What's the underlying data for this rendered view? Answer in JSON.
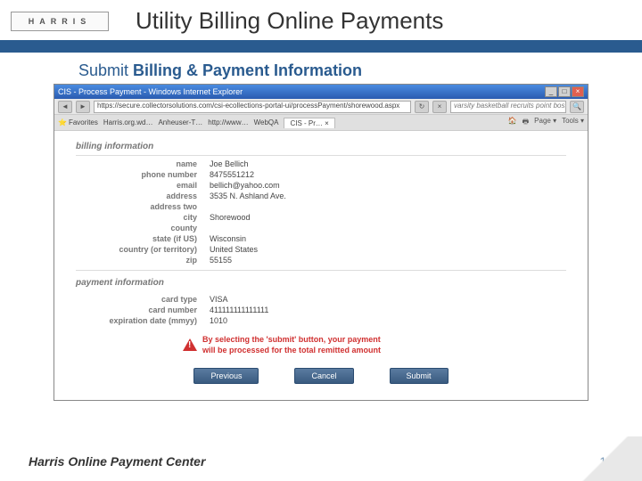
{
  "logo_text": "HARRIS",
  "title": "Utility Billing Online Payments",
  "subtitle_plain": "Submit ",
  "subtitle_bold": "Billing & Payment Information",
  "browser": {
    "window_title": "CIS - Process Payment - Windows Internet Explorer",
    "url": "https://secure.collectorsolutions.com/csi-ecollections-portal-ui/processPayment/shorewood.aspx",
    "search_placeholder": "varsity basketball recruits point boster",
    "fav_label": "Favorites",
    "tab_links": [
      "Harris.org.wd…",
      "Anheuser-T…",
      "http://www…",
      "WebQA"
    ],
    "active_tab": "CIS - Pr…  ×",
    "tools": [
      "Page ▾",
      "Tools ▾"
    ]
  },
  "billing": {
    "section": "billing information",
    "rows": {
      "name": {
        "label": "name",
        "value": "Joe Bellich"
      },
      "phone": {
        "label": "phone number",
        "value": "8475551212"
      },
      "email": {
        "label": "email",
        "value": "bellich@yahoo.com"
      },
      "address": {
        "label": "address",
        "value": "3535 N. Ashland Ave."
      },
      "address2": {
        "label": "address two",
        "value": ""
      },
      "city": {
        "label": "city",
        "value": "Shorewood"
      },
      "county": {
        "label": "county",
        "value": ""
      },
      "state": {
        "label": "state (if US)",
        "value": "Wisconsin"
      },
      "country": {
        "label": "country (or territory)",
        "value": "United States"
      },
      "zip": {
        "label": "zip",
        "value": "55155"
      }
    }
  },
  "payment": {
    "section": "payment information",
    "rows": {
      "card_type": {
        "label": "card type",
        "value": "VISA"
      },
      "card_number": {
        "label": "card number",
        "value": "411111111111111"
      },
      "exp": {
        "label": "expiration date (mmyy)",
        "value": "1010"
      }
    }
  },
  "warning_line1": "By selecting the 'submit' button, your payment",
  "warning_line2": "will be processed for the total remitted amount",
  "buttons": {
    "prev": "Previous",
    "cancel": "Cancel",
    "submit": "Submit"
  },
  "footer_text": "Harris Online Payment Center",
  "page_number": "12"
}
